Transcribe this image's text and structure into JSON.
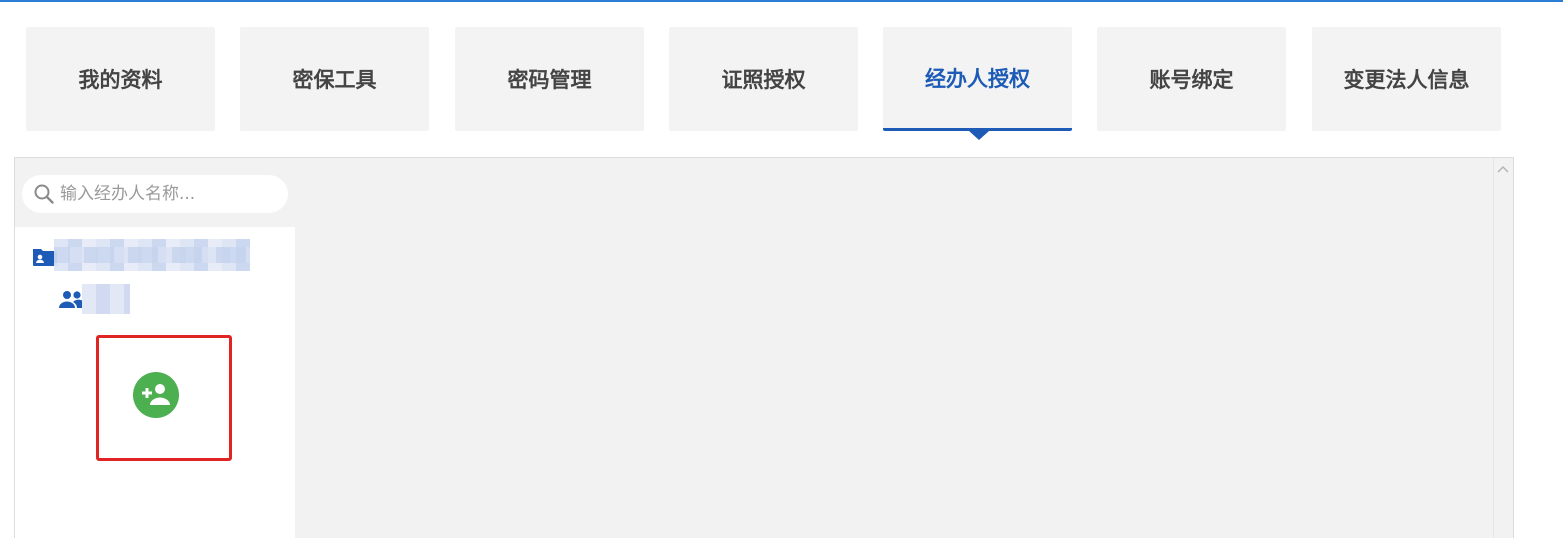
{
  "accent_color": "#1d5bb7",
  "tabs": [
    {
      "label": "我的资料",
      "active": false
    },
    {
      "label": "密保工具",
      "active": false
    },
    {
      "label": "密码管理",
      "active": false
    },
    {
      "label": "证照授权",
      "active": false
    },
    {
      "label": "经办人授权",
      "active": true
    },
    {
      "label": "账号绑定",
      "active": false
    },
    {
      "label": "变更法人信息",
      "active": false
    }
  ],
  "search": {
    "placeholder": "输入经办人名称...",
    "icon": "search-icon"
  },
  "tree": {
    "org_icon": "org-folder-icon",
    "group_icon": "people-icon"
  },
  "add_agent": {
    "icon": "add-user-icon",
    "color": "#4caf50",
    "highlight_color": "#e02424"
  }
}
